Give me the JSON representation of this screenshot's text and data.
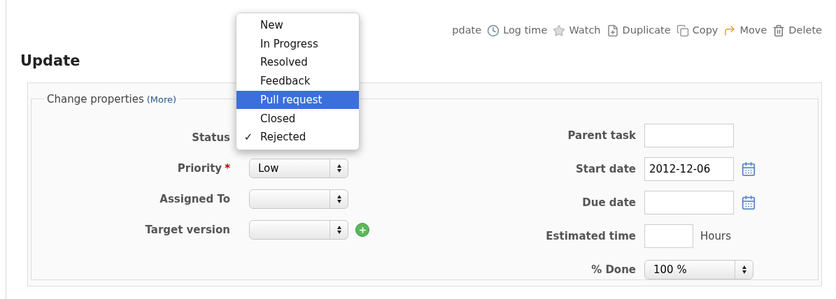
{
  "toolbar": [
    {
      "kind": "text",
      "label": "pdate"
    },
    {
      "kind": "clock",
      "label": "Log time"
    },
    {
      "kind": "star",
      "label": "Watch"
    },
    {
      "kind": "duplicate",
      "label": "Duplicate"
    },
    {
      "kind": "copy",
      "label": "Copy"
    },
    {
      "kind": "move",
      "label": "Move"
    },
    {
      "kind": "trash",
      "label": "Delete"
    }
  ],
  "heading": "Update",
  "fieldset": {
    "legend": "Change properties",
    "more_link": "(More)"
  },
  "left_fields": [
    {
      "label": "Status"
    },
    {
      "label": "Priority",
      "required_mark": "*",
      "kind": "select",
      "value": "Low",
      "add_button": false
    },
    {
      "label": "Assigned To",
      "kind": "select",
      "add_button": false
    },
    {
      "label": "Target version",
      "kind": "select",
      "add_button": true
    }
  ],
  "right_fields": [
    {
      "label": "Parent task",
      "kind": "text"
    },
    {
      "label": "Start date",
      "kind": "date",
      "value": "2012-12-06"
    },
    {
      "label": "Due date",
      "kind": "date"
    },
    {
      "label": "Estimated time",
      "kind": "hours",
      "unit": "Hours"
    },
    {
      "label": "% Done",
      "kind": "select",
      "value": "100 %"
    }
  ],
  "status_menu": [
    {
      "label": "New",
      "selected": false,
      "checked": false
    },
    {
      "label": "In Progress",
      "selected": false,
      "checked": false
    },
    {
      "label": "Resolved",
      "selected": false,
      "checked": false
    },
    {
      "label": "Feedback",
      "selected": false,
      "checked": false
    },
    {
      "label": "Pull request",
      "selected": true,
      "checked": false
    },
    {
      "label": "Closed",
      "selected": false,
      "checked": false
    },
    {
      "label": "Rejected",
      "selected": false,
      "checked": true
    }
  ],
  "check_mark": "✓"
}
